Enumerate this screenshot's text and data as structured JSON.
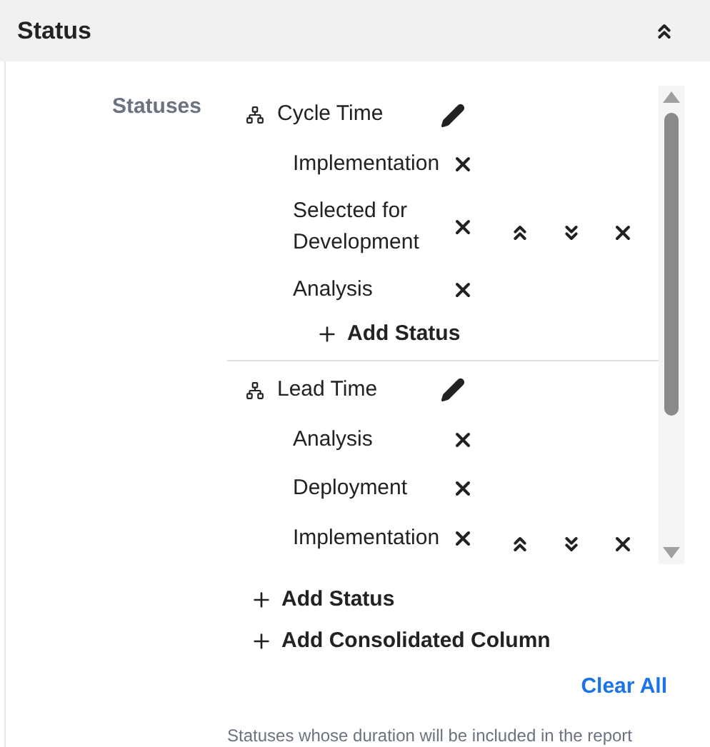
{
  "header": {
    "title": "Status"
  },
  "field": {
    "label": "Statuses"
  },
  "groups": [
    {
      "name": "Cycle Time",
      "add_label": "Add Status",
      "items": [
        {
          "name": "Implementation",
          "reorder_controls": false
        },
        {
          "name": "Selected for Development",
          "reorder_controls": true
        },
        {
          "name": "Analysis",
          "reorder_controls": false
        }
      ]
    },
    {
      "name": "Lead Time",
      "items": [
        {
          "name": "Analysis",
          "reorder_controls": false
        },
        {
          "name": "Deployment",
          "reorder_controls": false
        },
        {
          "name": "Implementation",
          "reorder_controls": true
        }
      ]
    }
  ],
  "actions": [
    "Add Status",
    "Add Consolidated Column"
  ],
  "clear_all": "Clear All",
  "help_text": "Statuses whose duration will be included in the report"
}
